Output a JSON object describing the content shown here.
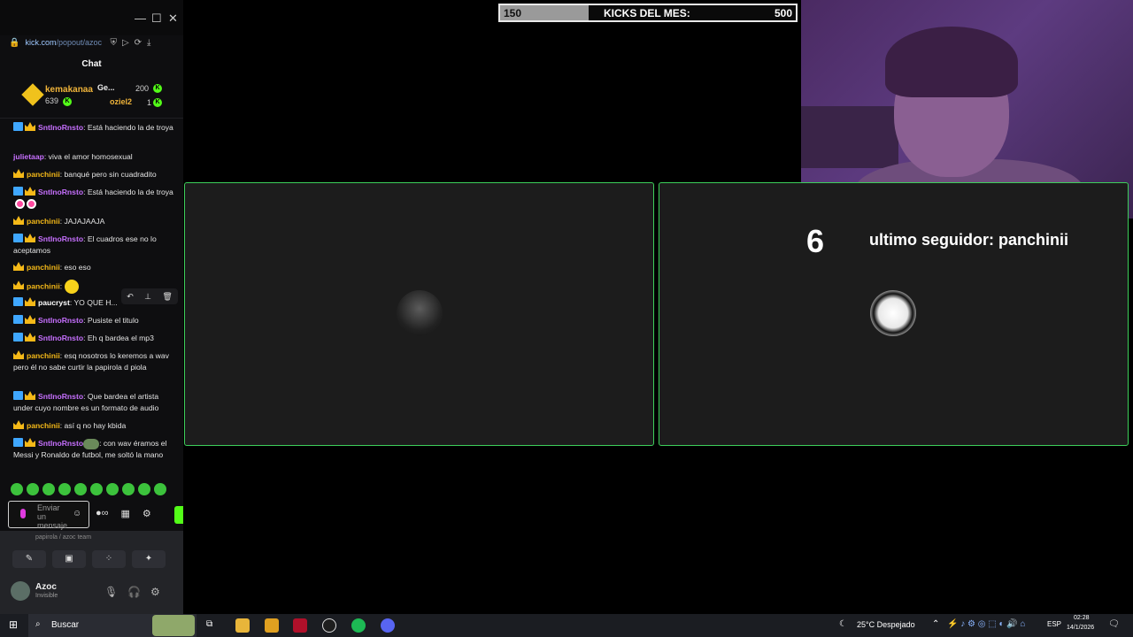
{
  "window": {
    "minimize": "—",
    "maximize": "☐",
    "close": "✕"
  },
  "url": {
    "host": "kick.com",
    "path": "/popout/azoc"
  },
  "chat": {
    "title": "Chat",
    "leaderboard": [
      {
        "name": "kemakanaa",
        "value": "639"
      },
      {
        "name": "Ge...",
        "value": "200"
      },
      {
        "name": "oziel2",
        "value": "1"
      }
    ],
    "messages": [
      {
        "user": "SntInoRnsto",
        "color": "#c770ff",
        "text": ": Está haciendo la de troya"
      },
      {
        "user": "julietaap",
        "color": "#c770ff",
        "text": ": viva el amor homosexual"
      },
      {
        "user": "panchinii",
        "color": "#f5b918",
        "text": ": banqué pero sin cuadradito"
      },
      {
        "user": "SntInoRnsto",
        "color": "#c770ff",
        "text": ": Está haciendo la de troya"
      },
      {
        "user": "panchinii",
        "color": "#f5b918",
        "text": ": JAJAJAAJA"
      },
      {
        "user": "SntInoRnsto",
        "color": "#c770ff",
        "text": ": El cuadros ese no lo aceptamos"
      },
      {
        "user": "panchinii",
        "color": "#f5b918",
        "text": ": eso eso"
      },
      {
        "user": "panchinii",
        "color": "#f5b918",
        "text": ":"
      },
      {
        "user": "paucryst",
        "color": "#ffffff",
        "text": ": YO QUE H..."
      },
      {
        "user": "SntInoRnsto",
        "color": "#c770ff",
        "text": ": Pusiste el titulo"
      },
      {
        "user": "SntInoRnsto",
        "color": "#c770ff",
        "text": ": Eh q bardea el mp3"
      },
      {
        "user": "panchinii",
        "color": "#f5b918",
        "text": ": esq nosotros lo keremos a wav pero él no sabe curtir la papirola d piola"
      },
      {
        "user": "SntInoRnsto",
        "color": "#c770ff",
        "text": ": Que bardea el artista under cuyo nombre es un formato de audio"
      },
      {
        "user": "panchinii",
        "color": "#f5b918",
        "text": ": así q no hay kbida"
      },
      {
        "user": "SntInoRnsto",
        "color": "#c770ff",
        "text": ": con wav éramos el Messi y Ronaldo de futbol, me soltó la mano"
      }
    ],
    "input_placeholder": "Enviar un mensaje"
  },
  "discord": {
    "crumb": "papirola / azoc team",
    "username": "Azoc",
    "status": "Invisible"
  },
  "overlay": {
    "kicks_current": "150",
    "kicks_label": "KICKS DEL MES:",
    "kicks_goal": "500",
    "kicks_progress": 0.3,
    "follow_count": "6",
    "follow_text": "ultimo seguidor: panchinii"
  },
  "taskbar": {
    "search": "Buscar",
    "weather": "25°C  Despejado",
    "lang": "ESP",
    "time": "02:28",
    "date": "14/1/2026"
  },
  "colors": {
    "accent": "#53fc18",
    "panel_border": "#3dcf5a"
  }
}
